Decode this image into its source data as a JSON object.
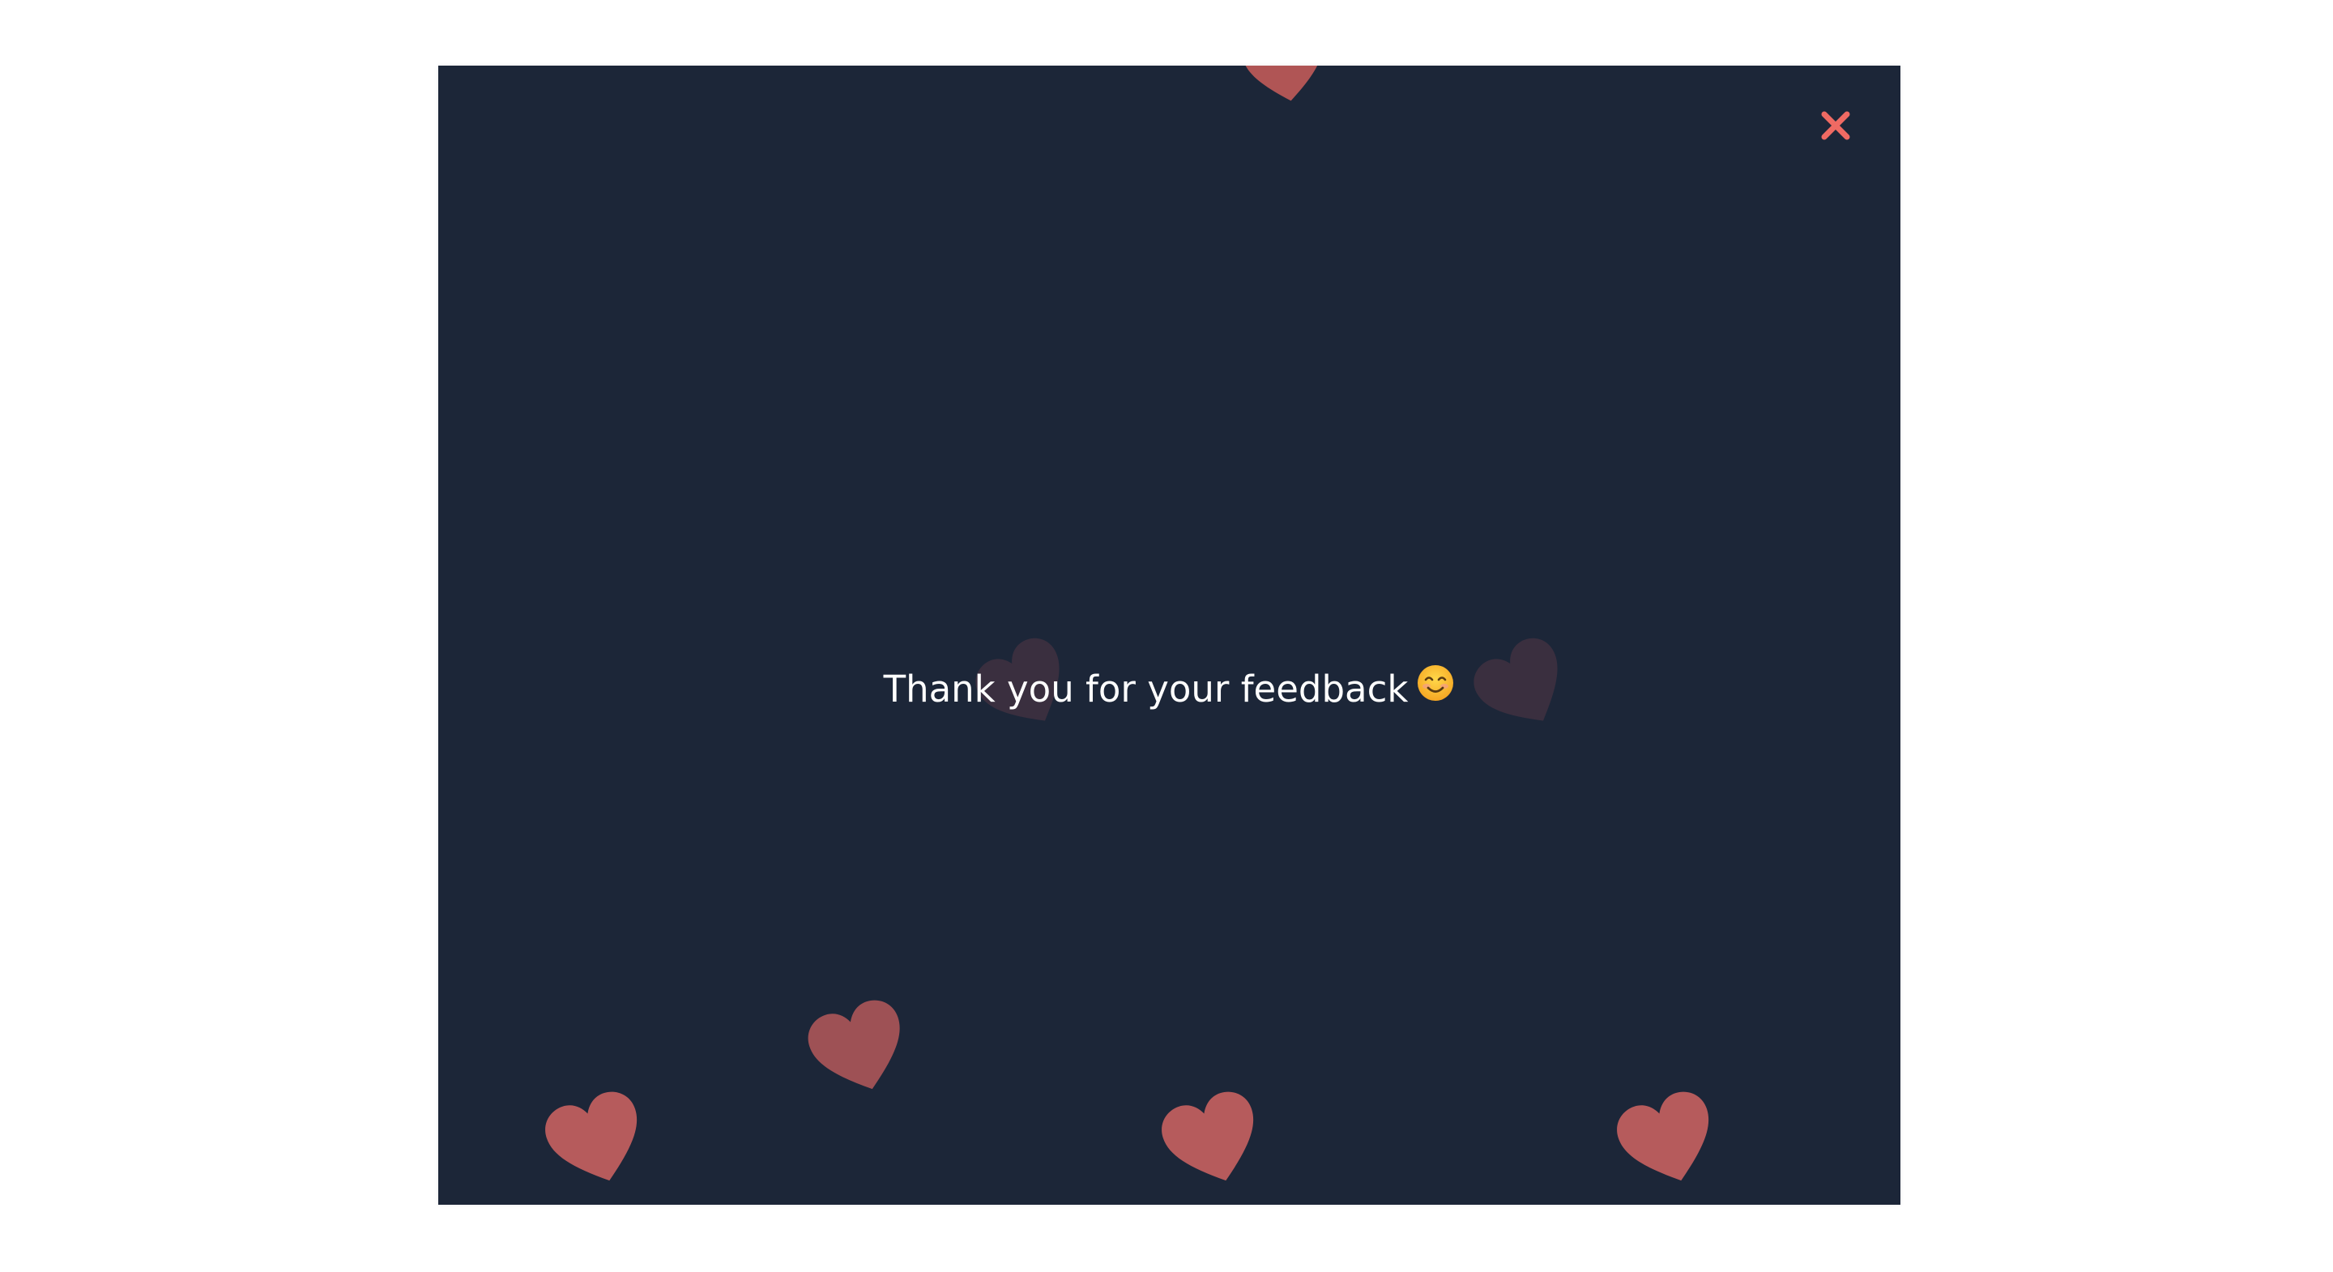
{
  "dialog": {
    "message": "Thank you for your feedback",
    "emoji_icon": "smiling-face-emoji-icon",
    "close_icon": "close-icon"
  },
  "colors": {
    "page_background": "#ffffff",
    "modal_background": "#1c2638",
    "close_accent": "#ef6a63",
    "heart_bright": "#b65b5c",
    "heart_medium": "#9e5155",
    "heart_faint": "#3a2f3f",
    "text": "#ffffff"
  }
}
